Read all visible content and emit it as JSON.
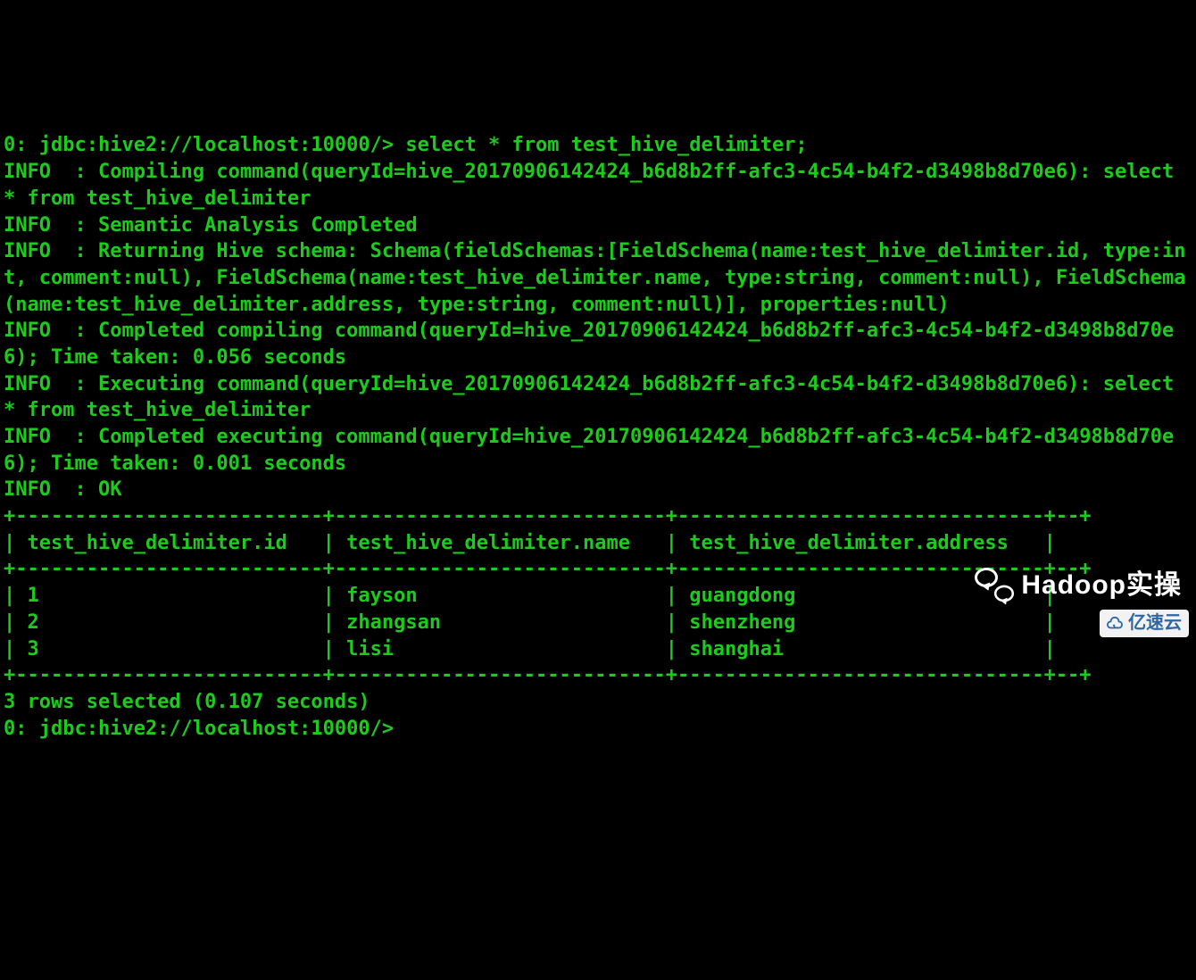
{
  "terminal": {
    "prompt": "0: jdbc:hive2://localhost:10000/>",
    "command": "select * from test_hive_delimiter;",
    "prompt2": "0: jdbc:hive2://localhost:10000/>",
    "log_lines": [
      "INFO  : Compiling command(queryId=hive_20170906142424_b6d8b2ff-afc3-4c54-b4f2-d3498b8d70e6): select * from test_hive_delimiter",
      "INFO  : Semantic Analysis Completed",
      "INFO  : Returning Hive schema: Schema(fieldSchemas:[FieldSchema(name:test_hive_delimiter.id, type:int, comment:null), FieldSchema(name:test_hive_delimiter.name, type:string, comment:null), FieldSchema(name:test_hive_delimiter.address, type:string, comment:null)], properties:null)",
      "INFO  : Completed compiling command(queryId=hive_20170906142424_b6d8b2ff-afc3-4c54-b4f2-d3498b8d70e6); Time taken: 0.056 seconds",
      "INFO  : Executing command(queryId=hive_20170906142424_b6d8b2ff-afc3-4c54-b4f2-d3498b8d70e6): select * from test_hive_delimiter",
      "INFO  : Completed executing command(queryId=hive_20170906142424_b6d8b2ff-afc3-4c54-b4f2-d3498b8d70e6); Time taken: 0.001 seconds",
      "INFO  : OK"
    ],
    "table": {
      "sep": "+--------------------------+----------------------------+-------------------------------+--+",
      "header": "| test_hive_delimiter.id   | test_hive_delimiter.name   | test_hive_delimiter.address   |",
      "columns": [
        "test_hive_delimiter.id",
        "test_hive_delimiter.name",
        "test_hive_delimiter.address"
      ],
      "rows_raw": [
        "| 1                        | fayson                     | guangdong                     |",
        "| 2                        | zhangsan                   | shenzheng                     |",
        "| 3                        | lisi                       | shanghai                      |"
      ],
      "rows": [
        {
          "id": "1",
          "name": "fayson",
          "address": "guangdong"
        },
        {
          "id": "2",
          "name": "zhangsan",
          "address": "shenzheng"
        },
        {
          "id": "3",
          "name": "lisi",
          "address": "shanghai"
        }
      ]
    },
    "footer": "3 rows selected (0.107 seconds)"
  },
  "watermarks": {
    "wechat_label": "Hadoop实操",
    "yisu_label": "亿速云"
  }
}
